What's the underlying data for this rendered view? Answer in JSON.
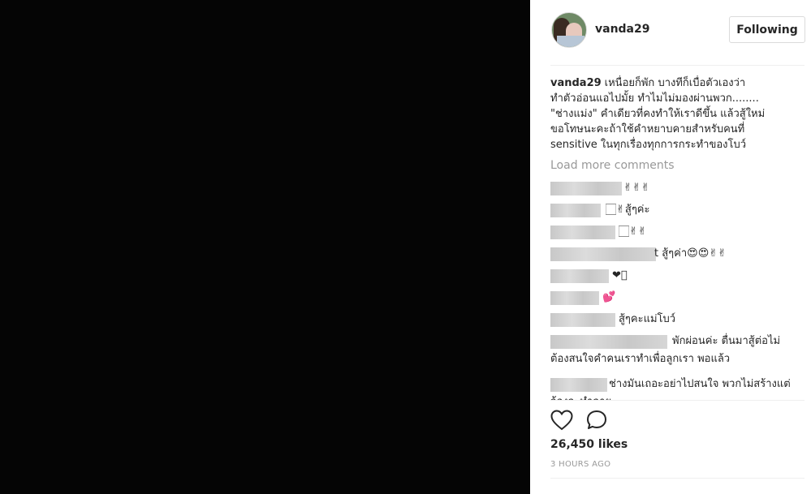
{
  "post": {
    "username": "vanda29",
    "follow_label": "Following",
    "caption_user": "vanda29",
    "caption_text": "เหนื่อยก็พัก บางทีก็เบื่อตัวเองว่าทำตัวอ่อนแอไปมั้ย ทำไมไม่มองผ่านพวก........ \"ช่างแม่ง\" คำเดียวที่คงทำให้เราดีขึ้น แล้วสู้ใหม่ ขอโทษนะคะถ้าใช้คำหยาบคายสำหรับคนที่ sensitive ในทุกเรื่องทุกการกระทำของโบว์",
    "load_more": "Load more comments",
    "likes": "26,450 likes",
    "time": "3 HOURS AGO"
  },
  "comments": [
    {
      "text": "✌✌✌"
    },
    {
      "text": "🏻✌สู้ๆค่ะ"
    },
    {
      "text": "🏻✌✌"
    },
    {
      "text": "t สู้ๆค่า😍😍✌✌"
    },
    {
      "text": "❤🏻"
    },
    {
      "text": "💕"
    },
    {
      "text": "สู้ๆคะแม่โบว์"
    },
    {
      "text": "พักผ่อนค่ะ ตื่นมาสู้ต่อไม่ต้องสนใจคำคนเราทำเพื่อลูกเรา พอแล้ว"
    },
    {
      "text": "ช่างมันเถอะอย่าไปสนใจ พวกไม่สร้างแต่จ้องจะทำลาย"
    }
  ],
  "icons": {
    "like": "heart-icon",
    "comment": "comment-icon"
  },
  "colors": {
    "photo_bg": "#050505",
    "text": "#262626",
    "muted": "#999999",
    "border": "#dbdbdb"
  }
}
